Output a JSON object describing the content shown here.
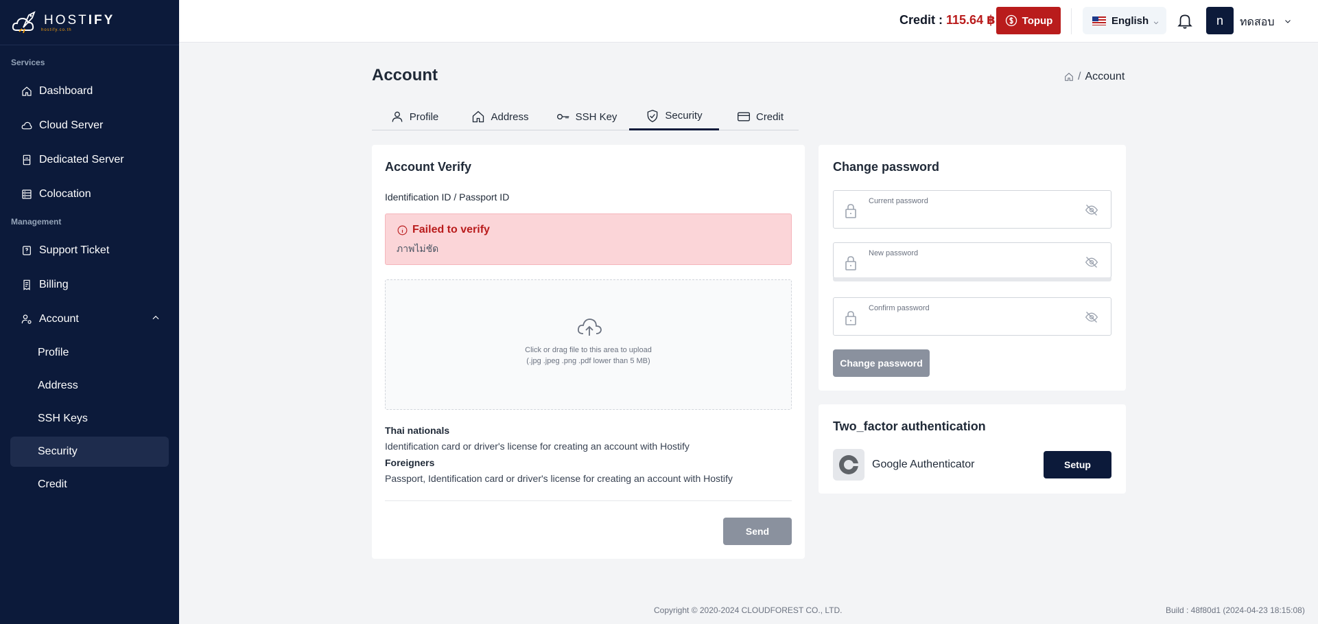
{
  "brand": {
    "name_bold": "IFY",
    "name_thin": "HOST",
    "tagline": "hostify.co.th"
  },
  "sidebar": {
    "section_services": "Services",
    "services": [
      {
        "label": "Dashboard",
        "icon": "home-icon"
      },
      {
        "label": "Cloud Server",
        "icon": "cloud-icon"
      },
      {
        "label": "Dedicated Server",
        "icon": "server-icon"
      },
      {
        "label": "Colocation",
        "icon": "rack-icon"
      }
    ],
    "section_management": "Management",
    "management": [
      {
        "label": "Support Ticket",
        "icon": "ticket-icon"
      },
      {
        "label": "Billing",
        "icon": "receipt-icon"
      },
      {
        "label": "Account",
        "icon": "user-gear-icon"
      }
    ],
    "account_sub": [
      {
        "label": "Profile"
      },
      {
        "label": "Address"
      },
      {
        "label": "SSH Keys"
      },
      {
        "label": "Security",
        "active": true
      },
      {
        "label": "Credit"
      }
    ]
  },
  "topbar": {
    "credit_label": "Credit :",
    "credit_amount": "115.64 ฿",
    "topup_label": "Topup",
    "language": "English",
    "avatar_initial": "n",
    "username": "ทดสอบ"
  },
  "page": {
    "title": "Account",
    "breadcrumb_current": "Account",
    "breadcrumb_sep": "/"
  },
  "tabs": [
    {
      "label": "Profile",
      "icon": "user-icon"
    },
    {
      "label": "Address",
      "icon": "home-icon"
    },
    {
      "label": "SSH Key",
      "icon": "key-icon"
    },
    {
      "label": "Security",
      "icon": "shield-check-icon",
      "active": true
    },
    {
      "label": "Credit",
      "icon": "credit-card-icon"
    }
  ],
  "verify": {
    "title": "Account Verify",
    "id_label": "Identification ID / Passport ID",
    "alert_title": "Failed to verify",
    "alert_message": "ภาพไม่ชัด",
    "upload_line1": "Click or drag file to this area to upload",
    "upload_line2": "(.jpg .jpeg .png .pdf lower than 5 MB)",
    "thai_title": "Thai nationals",
    "thai_desc": "Identification card or driver's license for creating an account with Hostify",
    "foreign_title": "Foreigners",
    "foreign_desc": "Passport, Identification card or driver's license for creating an account with Hostify",
    "send_label": "Send"
  },
  "password": {
    "title": "Change password",
    "current_label": "Current password",
    "new_label": "New password",
    "confirm_label": "Confirm password",
    "button_label": "Change password"
  },
  "tfa": {
    "title": "Two_factor authentication",
    "provider": "Google Authenticator",
    "button_label": "Setup"
  },
  "footer": {
    "copyright": "Copyright © 2020-2024 CLOUDFOREST CO., LTD.",
    "build": "Build : 48f80d1 (2024-04-23 18:15:08)"
  },
  "colors": {
    "sidebar": "#0c1a3a",
    "accent_red": "#b91c1c",
    "disabled": "#8a919e"
  }
}
